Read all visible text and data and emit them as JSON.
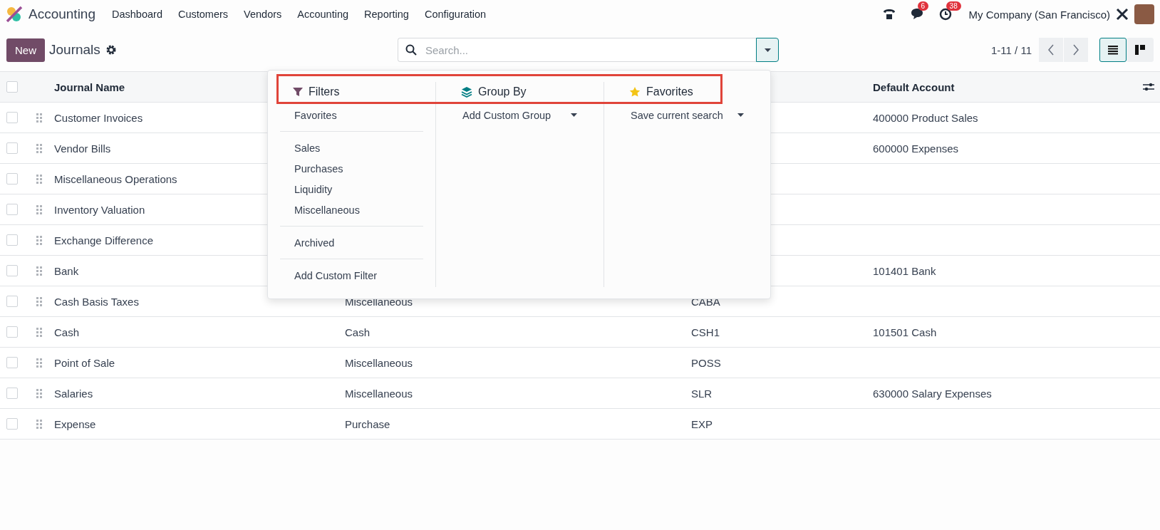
{
  "app": {
    "name": "Accounting"
  },
  "menu": [
    "Dashboard",
    "Customers",
    "Vendors",
    "Accounting",
    "Reporting",
    "Configuration"
  ],
  "systray": {
    "messages_badge": "6",
    "activities_badge": "38",
    "company": "My Company (San Francisco)"
  },
  "control": {
    "new_button": "New",
    "title": "Journals",
    "search": {
      "placeholder": "Search..."
    },
    "pager": "1-11 / 11",
    "views": [
      {
        "kind": "list",
        "selected": true
      },
      {
        "kind": "kanban",
        "selected": false
      }
    ]
  },
  "search_panel": {
    "highlighted": true,
    "filters": {
      "title": "Filters",
      "groups": [
        [
          "Favorites"
        ],
        [
          "Sales",
          "Purchases",
          "Liquidity",
          "Miscellaneous"
        ],
        [
          "Archived"
        ],
        [
          "Add Custom Filter"
        ]
      ]
    },
    "group_by": {
      "title": "Group By",
      "items": [
        "Add Custom Group"
      ]
    },
    "favorites": {
      "title": "Favorites",
      "items": [
        "Save current search"
      ]
    }
  },
  "table": {
    "select_all_checked": false,
    "columns": [
      "Journal Name",
      "Default Account"
    ],
    "rows": [
      {
        "name": "Customer Invoices",
        "account": "400000 Product Sales",
        "checked": false
      },
      {
        "name": "Vendor Bills",
        "account": "600000 Expenses",
        "checked": false
      },
      {
        "name": "Miscellaneous Operations",
        "checked": false
      },
      {
        "name": "Inventory Valuation",
        "checked": false
      },
      {
        "name": "Exchange Difference",
        "checked": false
      },
      {
        "name": "Bank",
        "account": "101401 Bank",
        "checked": false
      },
      {
        "name": "Cash Basis Taxes",
        "type": "Miscellaneous",
        "code": "CABA",
        "checked": false
      },
      {
        "name": "Cash",
        "type": "Cash",
        "code": "CSH1",
        "account": "101501 Cash",
        "checked": false
      },
      {
        "name": "Point of Sale",
        "type": "Miscellaneous",
        "code": "POSS",
        "checked": false
      },
      {
        "name": "Salaries",
        "type": "Miscellaneous",
        "code": "SLR",
        "account": "630000 Salary Expenses",
        "checked": false
      },
      {
        "name": "Expense",
        "type": "Purchase",
        "code": "EXP",
        "checked": false
      }
    ]
  }
}
